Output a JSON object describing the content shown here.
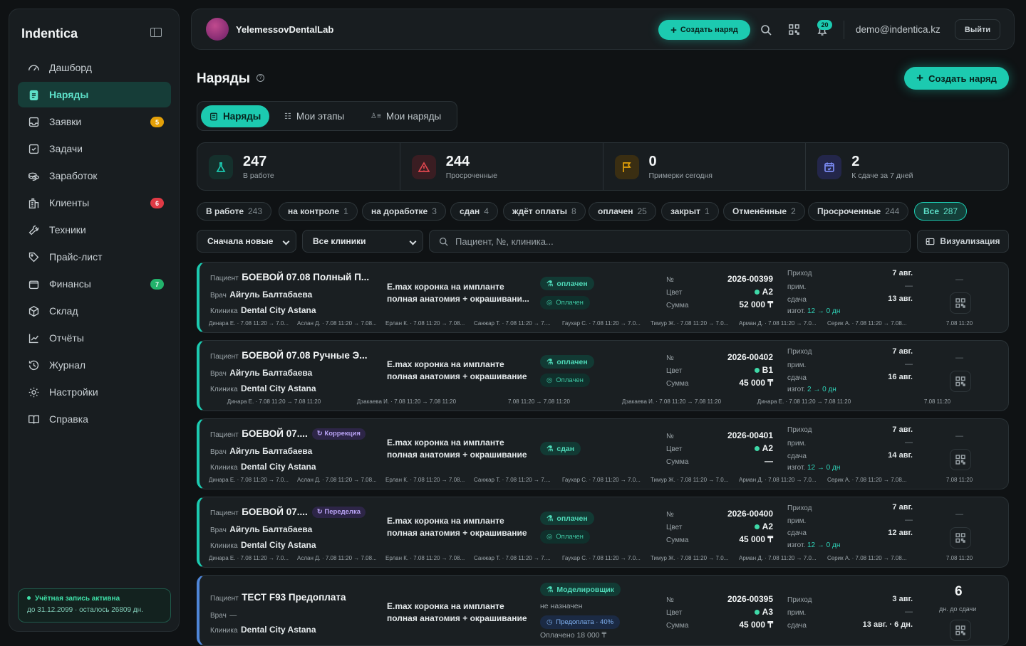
{
  "app": {
    "name": "Indentica"
  },
  "sidebar": {
    "items": [
      {
        "label": "Дашборд",
        "icon": "dashboard-icon"
      },
      {
        "label": "Наряды",
        "icon": "clipboard-icon",
        "active": true
      },
      {
        "label": "Заявки",
        "icon": "inbox-icon",
        "badge": "5",
        "badge_color": "#e3a008"
      },
      {
        "label": "Задачи",
        "icon": "checkbox-icon"
      },
      {
        "label": "Заработок",
        "icon": "coins-icon"
      },
      {
        "label": "Клиенты",
        "icon": "building-icon",
        "badge": "6",
        "badge_color": "#e03a45"
      },
      {
        "label": "Техники",
        "icon": "wrench-icon"
      },
      {
        "label": "Прайс-лист",
        "icon": "tag-icon"
      },
      {
        "label": "Финансы",
        "icon": "wallet-icon",
        "badge": "7",
        "badge_color": "#22b26b"
      },
      {
        "label": "Склад",
        "icon": "box-icon"
      },
      {
        "label": "Отчёты",
        "icon": "chart-icon"
      },
      {
        "label": "Журнал",
        "icon": "history-icon"
      },
      {
        "label": "Настройки",
        "icon": "gear-icon"
      },
      {
        "label": "Справка",
        "icon": "book-icon"
      }
    ],
    "account": {
      "title": "Учётная запись активна",
      "subtitle": "до 31.12.2099 · осталось 26809 дн."
    }
  },
  "topbar": {
    "lab_name": "YelemessovDentalLab",
    "create_label": "Создать наряд",
    "notifications": "20",
    "email": "demo@indentica.kz",
    "logout": "Выйти"
  },
  "page": {
    "title": "Наряды",
    "create_label": "Создать наряд",
    "tabs": [
      "Наряды",
      "Мои этапы",
      "Мои наряды"
    ]
  },
  "stats": [
    {
      "value": "247",
      "label": "В работе",
      "color": "#1ccab0"
    },
    {
      "value": "244",
      "label": "Просроченные",
      "color": "#e0474f"
    },
    {
      "value": "0",
      "label": "Примерки сегодня",
      "color": "#e3a008"
    },
    {
      "value": "2",
      "label": "К сдаче за 7 дней",
      "color": "#7c8cf5"
    }
  ],
  "filters": [
    {
      "label": "В работе",
      "count": "243"
    },
    {
      "label": "на контроле",
      "count": "1"
    },
    {
      "label": "на доработке",
      "count": "3"
    },
    {
      "label": "сдан",
      "count": "4"
    },
    {
      "label": "ждёт оплаты",
      "count": "8"
    },
    {
      "label": "оплачен",
      "count": "25"
    },
    {
      "label": "закрыт",
      "count": "1"
    },
    {
      "label": "Отменённые",
      "count": "2"
    },
    {
      "label": "Просроченные",
      "count": "244"
    },
    {
      "label": "Все",
      "count": "287",
      "active": true
    }
  ],
  "controls": {
    "sort": "Сначала новые",
    "clinic": "Все клиники",
    "search_placeholder": "Пациент, №, клиника...",
    "viz": "Визуализация"
  },
  "labels": {
    "patient": "Пациент",
    "doctor": "Врач",
    "clinic": "Клиника",
    "num": "№",
    "color": "Цвет",
    "sum": "Сумма",
    "incoming": "Приход",
    "fitting": "прим.",
    "delivery": "сдача",
    "made": "изгот."
  },
  "orders": [
    {
      "patient": "БОЕВОЙ 07.08 Полный П...",
      "doctor": "Айгуль Балтабаева",
      "clinic": "Dental City Astana",
      "work": "E.max коронка на импланте полная анатомия + окрашивани...",
      "status": "оплачен",
      "payment": "Оплачен",
      "number": "2026-00399",
      "shade": "A2",
      "sum": "52 000 ₸",
      "incoming": "7 авг.",
      "fitting": "—",
      "delivery": "13 авг.",
      "made": "12 → 0 дн",
      "stages": [
        "Динара Е. · 7.08 11:20 → 7.0...",
        "Аслан Д. · 7.08 11:20 → 7.08...",
        "Ерлан К. · 7.08 11:20 → 7.08...",
        "Санжар Т. · 7.08 11:20 → 7....",
        "Гаухар С. · 7.08 11:20 → 7.0...",
        "Тимур Ж. · 7.08 11:20 → 7.0...",
        "Арман Д. · 7.08 11:20 → 7.0...",
        "Серик А. · 7.08 11:20 → 7.08...",
        "7.08 11:20"
      ]
    },
    {
      "patient": "БОЕВОЙ 07.08 Ручные Э...",
      "doctor": "Айгуль Балтабаева",
      "clinic": "Dental City Astana",
      "work": "E.max коронка на импланте полная анатомия + окрашивание",
      "status": "оплачен",
      "payment": "Оплачен",
      "number": "2026-00402",
      "shade": "B1",
      "sum": "45 000 ₸",
      "incoming": "7 авг.",
      "fitting": "—",
      "delivery": "16 авг.",
      "made": "2 → 0 дн",
      "stages": [
        "Динара Е. · 7.08 11:20 → 7.08 11:20",
        "Дзакаева И. · 7.08 11:20 → 7.08 11:20",
        "7.08 11:20 → 7.08 11:20",
        "Дзакаева И. · 7.08 11:20 → 7.08 11:20",
        "Динара Е. · 7.08 11:20 → 7.08 11:20",
        "7.08 11:20"
      ]
    },
    {
      "patient": "БОЕВОЙ 07....",
      "tag": "Коррекция",
      "doctor": "Айгуль Балтабаева",
      "clinic": "Dental City Astana",
      "work": "E.max коронка на импланте полная анатомия + окрашивание",
      "status": "сдан",
      "number": "2026-00401",
      "shade": "A2",
      "sum": "—",
      "incoming": "7 авг.",
      "fitting": "—",
      "delivery": "14 авг.",
      "made": "12 → 0 дн",
      "stages": [
        "Динара Е. · 7.08 11:20 → 7.0...",
        "Аслан Д. · 7.08 11:20 → 7.08...",
        "Ерлан К. · 7.08 11:20 → 7.08...",
        "Санжар Т. · 7.08 11:20 → 7....",
        "Гаухар С. · 7.08 11:20 → 7.0...",
        "Тимур Ж. · 7.08 11:20 → 7.0...",
        "Арман Д. · 7.08 11:20 → 7.0...",
        "Серик А. · 7.08 11:20 → 7.08...",
        "7.08 11:20"
      ]
    },
    {
      "patient": "БОЕВОЙ 07....",
      "tag": "Переделка",
      "doctor": "Айгуль Балтабаева",
      "clinic": "Dental City Astana",
      "work": "E.max коронка на импланте полная анатомия + окрашивание",
      "status": "оплачен",
      "payment": "Оплачен",
      "number": "2026-00400",
      "shade": "A2",
      "sum": "45 000 ₸",
      "incoming": "7 авг.",
      "fitting": "—",
      "delivery": "12 авг.",
      "made": "12 → 0 дн",
      "stages": [
        "Динара Е. · 7.08 11:20 → 7.0...",
        "Аслан Д. · 7.08 11:20 → 7.08...",
        "Ерлан К. · 7.08 11:20 → 7.08...",
        "Санжар Т. · 7.08 11:20 → 7....",
        "Гаухар С. · 7.08 11:20 → 7.0...",
        "Тимур Ж. · 7.08 11:20 → 7.0...",
        "Арман Д. · 7.08 11:20 → 7.0...",
        "Серик А. · 7.08 11:20 → 7.08...",
        "7.08 11:20"
      ]
    },
    {
      "patient": "ТЕСТ F93 Предоплата",
      "doctor": "—",
      "clinic": "Dental City Astana",
      "work": "E.max коронка на импланте полная анатомия + окрашивание",
      "status": "Моделировщик",
      "status_note": "не назначен",
      "payment": "Предоплата · 40%",
      "paid": "Оплачено 18 000 ₸",
      "number": "2026-00395",
      "shade": "A3",
      "sum": "45 000 ₸",
      "incoming": "3 авг.",
      "fitting": "—",
      "delivery": "13 авг. · 6 дн.",
      "days_left": "6",
      "days_label": "дн. до сдачи"
    }
  ]
}
